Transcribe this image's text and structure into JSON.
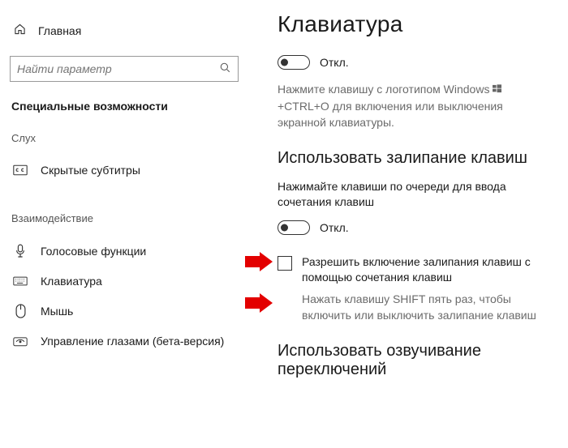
{
  "sidebar": {
    "home_label": "Главная",
    "search_placeholder": "Найти параметр",
    "section_title": "Специальные возможности",
    "group_hearing": "Слух",
    "group_interaction": "Взаимодействие",
    "items": {
      "closed_captions": "Скрытые субтитры",
      "speech": "Голосовые функции",
      "keyboard": "Клавиатура",
      "mouse": "Мышь",
      "eye_control": "Управление глазами (бета-версия)"
    }
  },
  "main": {
    "title": "Клавиатура",
    "onscreen_toggle_label": "Откл.",
    "onscreen_hint_a": "Нажмите клавишу с логотипом Windows",
    "onscreen_hint_b": "+CTRL+O для включения или выключения экранной клавиатуры.",
    "sticky_title": "Использовать залипание клавиш",
    "sticky_desc": "Нажимайте клавиши по очереди для ввода сочетания клавиш",
    "sticky_toggle_label": "Откл.",
    "sticky_check_label": "Разрешить включение залипания клавиш с помощью сочетания клавиш",
    "sticky_check_hint": "Нажать клавишу SHIFT пять раз, чтобы включить или выключить залипание клавиш",
    "toggle_keys_title": "Использовать озвучивание переключений"
  }
}
